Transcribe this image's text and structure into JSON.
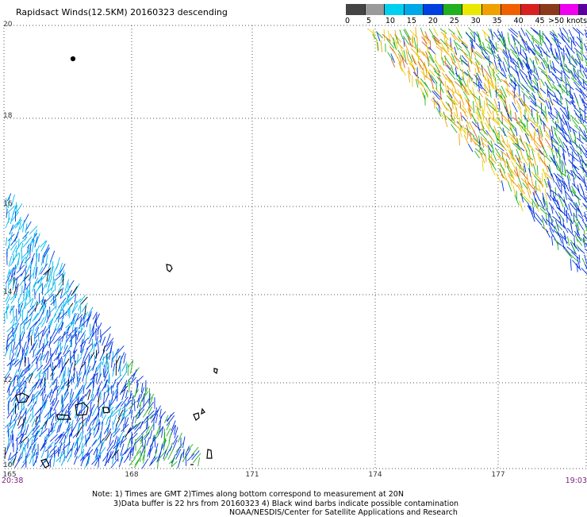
{
  "title": "Rapidsact Winds(12.5KM) 20160323 descending",
  "scale": {
    "labels": [
      "0",
      "5",
      "10",
      "15",
      "20",
      "25",
      "30",
      "35",
      "40",
      "45",
      ">50 knots"
    ],
    "colors": [
      "#444444",
      "#9a9a9a",
      "#00d0f0",
      "#00a8e8",
      "#0040e0",
      "#20b020",
      "#e8e800",
      "#f0a000",
      "#f06000",
      "#d82020",
      "#8a3a1a",
      "#f000f0",
      "#5a00a0"
    ]
  },
  "axes": {
    "lat_labels": [
      "20",
      "18",
      "16",
      "14",
      "12",
      "10"
    ],
    "lon_labels": [
      "165",
      "168",
      "171",
      "174",
      "177"
    ]
  },
  "times": {
    "start": "20:38",
    "end": "19:03"
  },
  "notes": {
    "line1": "Note: 1) Times are GMT 2)Times along bottom correspond to measurement at 20N",
    "line2": "3)Data buffer is 22 hrs from 20160323 4) Black wind barbs indicate possible contamination",
    "line3": "NOAA/NESDIS/Center for Satellite Applications and Research"
  }
}
